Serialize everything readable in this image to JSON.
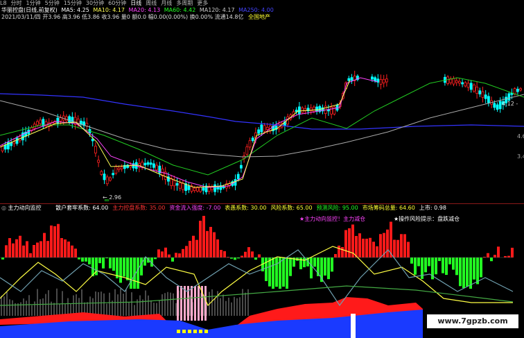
{
  "tabs": [
    "L8",
    "分时",
    "1分钟",
    "5分钟",
    "15分钟",
    "30分钟",
    "60分钟",
    "日线",
    "周线",
    "月线",
    "多周期",
    "更多"
  ],
  "active_tab": 7,
  "title": "华丽控盘(日线,前复权)",
  "ma": [
    {
      "label": "MA5: 4.25",
      "color": "#ffffff"
    },
    {
      "label": "MA10: 4.17",
      "color": "#ffff55"
    },
    {
      "label": "MA20: 4.13",
      "color": "#ff44ff"
    },
    {
      "label": "MA60: 4.42",
      "color": "#22ff22"
    },
    {
      "label": "MA120: 4.17",
      "color": "#cccccc"
    },
    {
      "label": "MA250: 4.00",
      "color": "#4444ff"
    }
  ],
  "info": "2021/03/11/四 开3.96 高3.96 低3.86 收3.96 量0 额0.0 幅0.00(0.00%) 换0.00% 流通14.8亿",
  "sector": "全国地产",
  "price_labels": {
    "left_low": "2.96",
    "right": "4.12",
    "y1": "4.6",
    "y2": "3.4"
  },
  "indicator": {
    "name": "主力动向监控",
    "fields": [
      {
        "label": "散户套牢系数: 64.00",
        "color": "#ffffff"
      },
      {
        "label": "主力控盘系数: 35.00",
        "color": "#ff3333"
      },
      {
        "label": "资金流入强度: -7.00",
        "color": "#ff44ff"
      },
      {
        "label": "表愚系数: 30.00",
        "color": "#ffff33"
      },
      {
        "label": "风险系数: 65.00",
        "color": "#ffff33"
      },
      {
        "label": "预测风险: 95.00",
        "color": "#22ff22"
      },
      {
        "label": "市场筹码总量: 64.60",
        "color": "#ffff33"
      },
      {
        "label": "上市: 0.98",
        "color": "#ffffff"
      }
    ],
    "tip1": "★主力动向监控！主力减仓",
    "tip2": "★操作风险提示：盘跌减仓"
  },
  "watermark": "www.7gpzb.com",
  "colors": {
    "up": "#ff2020",
    "down": "#00ffff",
    "bg": "#000000"
  }
}
